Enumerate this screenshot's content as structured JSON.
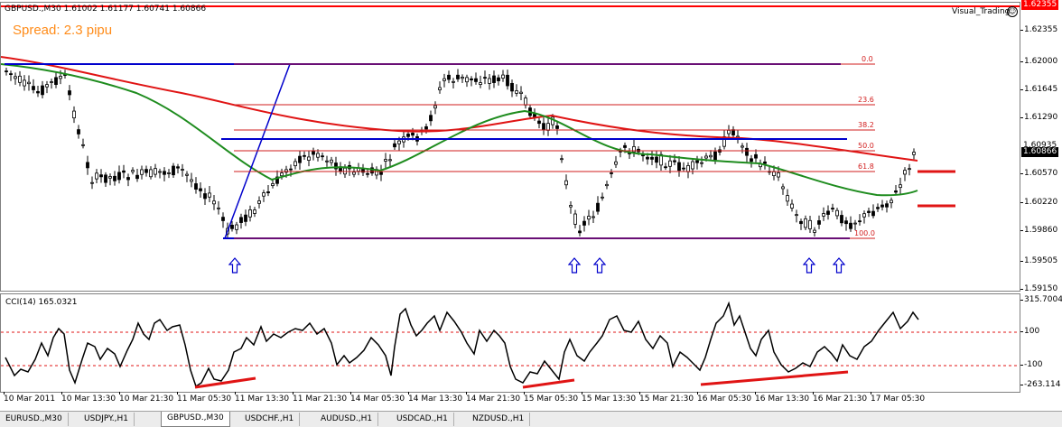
{
  "window": {
    "header": "GBPUSD.,M30  1.61002 1.61177 1.60741 1.60866",
    "spread_label": "Spread: 2.3 pipu",
    "ea_label": "Visual_Trading",
    "ea_face": "☺"
  },
  "price_scale": {
    "ticks": [
      "1.62355",
      "1.61645",
      "1.61290",
      "1.60935",
      "1.60570",
      "1.60220",
      "1.59860",
      "1.59505",
      "1.59150"
    ],
    "price_boxes": [
      "1.62355",
      "1.60935",
      "1.60866"
    ],
    "main_ticks": [
      "1.62355",
      "1.62000",
      "1.61645",
      "1.61290",
      "1.60935",
      "1.60570",
      "1.60220",
      "1.59860",
      "1.59505",
      "1.59150"
    ]
  },
  "fibo_levels": [
    "0.0",
    "23.6",
    "38.2",
    "50.0",
    "61.8",
    "100.0"
  ],
  "indicator": {
    "label": "CCI(14) 165.0321",
    "ticks": [
      "315.7004",
      "100",
      "-100",
      "-263.114"
    ]
  },
  "time_axis": [
    "10 Mar 2011",
    "10 Mar 13:30",
    "10 Mar 21:30",
    "11 Mar 05:30",
    "11 Mar 13:30",
    "11 Mar 21:30",
    "14 Mar 05:30",
    "14 Mar 13:30",
    "14 Mar 21:30",
    "15 Mar 05:30",
    "15 Mar 13:30",
    "15 Mar 21:30",
    "16 Mar 05:30",
    "16 Mar 13:30",
    "16 Mar 21:30",
    "17 Mar 05:30"
  ],
  "tabs": [
    "EURUSD.,M30",
    "USDJPY.,H1",
    "GBPUSD.,M30",
    "USDCHF.,H1",
    "AUDUSD.,H1",
    "USDCAD.,H1",
    "NZDUSD.,H1"
  ],
  "active_tab": "GBPUSD.,M30",
  "colors": {
    "ma_slow": "#e01414",
    "ma_fast": "#1e8c1e",
    "trendline": "#0000cc",
    "fibo": "#d21e1e",
    "spread": "#ff8c1a",
    "candle": "#000000"
  }
}
